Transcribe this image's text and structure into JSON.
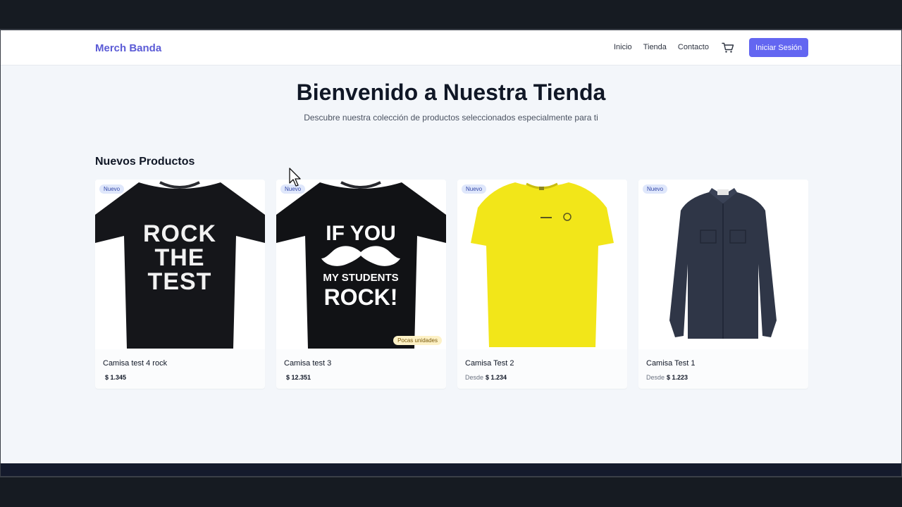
{
  "brand": "Merch Banda",
  "nav": {
    "links": [
      "Inicio",
      "Tienda",
      "Contacto"
    ],
    "login_label": "Iniciar Sesión"
  },
  "hero": {
    "title": "Bienvenido a Nuestra Tienda",
    "subtitle": "Descubre nuestra colección de productos seleccionados especialmente para ti"
  },
  "section_title": "Nuevos Productos",
  "products": [
    {
      "name": "Camisa test 4 rock",
      "price_prefix": "",
      "price": "$ 1.345",
      "badge": "Nuevo",
      "stock_badge": "",
      "print": [
        "ROCK",
        "THE",
        "TEST"
      ]
    },
    {
      "name": "Camisa test 3",
      "price_prefix": "",
      "price": "$ 12.351",
      "badge": "Nuevo",
      "stock_badge": "Pocas unidades",
      "print": [
        "IF YOU",
        "MY STUDENTS",
        "ROCK!"
      ]
    },
    {
      "name": "Camisa Test 2",
      "price_prefix": "Desde",
      "price": "$ 1.234",
      "badge": "Nuevo",
      "stock_badge": ""
    },
    {
      "name": "Camisa Test 1",
      "price_prefix": "Desde",
      "price": "$ 1.223",
      "badge": "Nuevo",
      "stock_badge": ""
    }
  ],
  "colors": {
    "brand": "#5b5bd6",
    "primary_button": "#6366f1",
    "badge_new": "#dfe7fb",
    "badge_low": "#fdf1c6",
    "shirt_yellow": "#f2e619",
    "shirt_navy": "#2f3647"
  }
}
